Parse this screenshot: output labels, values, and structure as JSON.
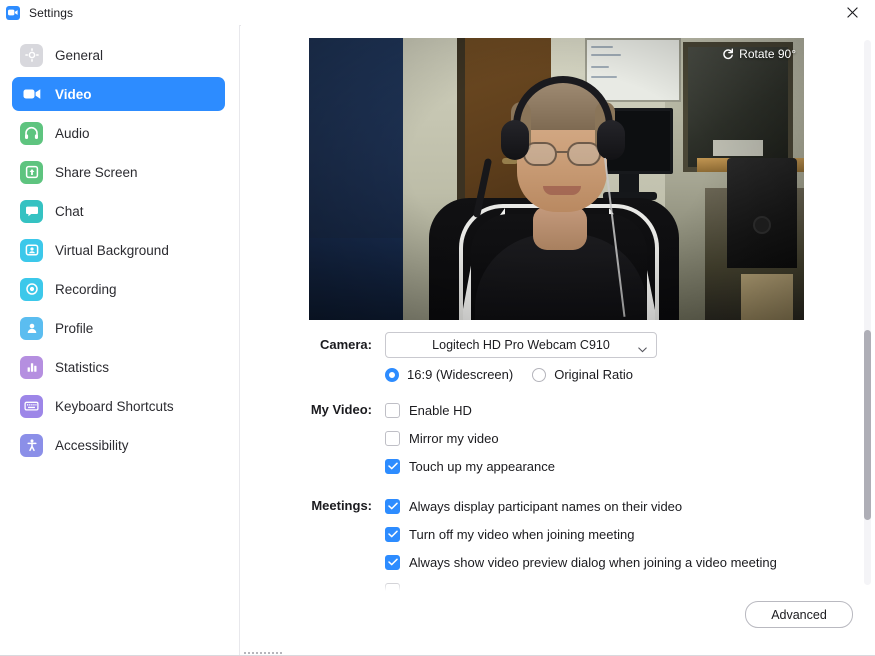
{
  "window": {
    "title": "Settings",
    "app_icon": "zoom-camera-icon",
    "close_icon": "close-icon"
  },
  "sidebar": {
    "items": [
      {
        "label": "General",
        "icon": "gear-icon",
        "color": "#d8d8dd",
        "active": false
      },
      {
        "label": "Video",
        "icon": "video-camera-icon",
        "color": "#2d8cff",
        "active": true
      },
      {
        "label": "Audio",
        "icon": "headphones-icon",
        "color": "#5ec47f",
        "active": false
      },
      {
        "label": "Share Screen",
        "icon": "share-screen-icon",
        "color": "#5ec47f",
        "active": false
      },
      {
        "label": "Chat",
        "icon": "chat-bubble-icon",
        "color": "#35c2c2",
        "active": false
      },
      {
        "label": "Virtual Background",
        "icon": "virtual-background-icon",
        "color": "#3cc8ea",
        "active": false
      },
      {
        "label": "Recording",
        "icon": "record-circle-icon",
        "color": "#3cc8ea",
        "active": false
      },
      {
        "label": "Profile",
        "icon": "person-icon",
        "color": "#5bbdf0",
        "active": false
      },
      {
        "label": "Statistics",
        "icon": "bar-chart-icon",
        "color": "#b58fe0",
        "active": false
      },
      {
        "label": "Keyboard Shortcuts",
        "icon": "keyboard-icon",
        "color": "#9d86e8",
        "active": false
      },
      {
        "label": "Accessibility",
        "icon": "accessibility-icon",
        "color": "#8b8fe8",
        "active": false
      }
    ]
  },
  "preview": {
    "rotate_label": "Rotate 90°",
    "rotate_icon": "rotate-icon"
  },
  "form": {
    "camera": {
      "label": "Camera:",
      "selected": "Logitech HD Pro Webcam C910",
      "caret_icon": "chevron-down-icon",
      "ratio_options": [
        {
          "label": "16:9 (Widescreen)",
          "selected": true
        },
        {
          "label": "Original Ratio",
          "selected": false
        }
      ]
    },
    "my_video": {
      "label": "My Video:",
      "checkboxes": [
        {
          "label": "Enable HD",
          "checked": false
        },
        {
          "label": "Mirror my video",
          "checked": false
        },
        {
          "label": "Touch up my appearance",
          "checked": true
        }
      ]
    },
    "meetings": {
      "label": "Meetings:",
      "checkboxes": [
        {
          "label": "Always display participant names on their video",
          "checked": true
        },
        {
          "label": "Turn off my video when joining meeting",
          "checked": true
        },
        {
          "label": "Always show video preview dialog when joining a video meeting",
          "checked": true
        }
      ]
    }
  },
  "footer": {
    "advanced_label": "Advanced"
  },
  "colors": {
    "accent": "#2d8cff",
    "text": "#1b1b1f",
    "border": "#c9c9cf",
    "scrollbar_thumb": "#aeaeb6"
  }
}
